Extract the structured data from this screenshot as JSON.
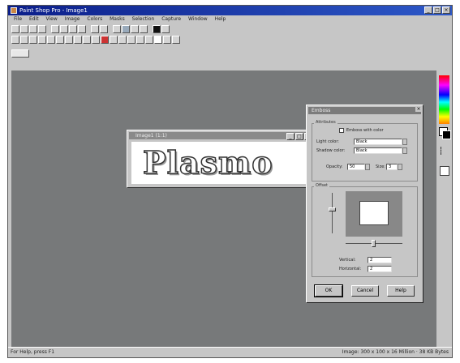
{
  "window": {
    "title": "Paint Shop Pro - Image1",
    "buttons": [
      "_",
      "□",
      "×"
    ]
  },
  "menu": [
    "File",
    "Edit",
    "View",
    "Image",
    "Colors",
    "Masks",
    "Selection",
    "Capture",
    "Window",
    "Help"
  ],
  "document": {
    "title": "Image1 (1:1)",
    "buttons": [
      "_",
      "□",
      "×"
    ],
    "text": "Plasmo"
  },
  "dialog": {
    "title": "Emboss",
    "close": "×",
    "attributes_label": "Attributes",
    "checkbox_label": "Emboss with color",
    "color_label": "Light color:",
    "color_value": "Black",
    "shadow_label": "Shadow color:",
    "shadow_value": "Black",
    "opacity_label": "Opacity:",
    "opacity_value": "50",
    "size_label": "Size:",
    "size_value": "3",
    "offset_label": "Offset",
    "vertical_label": "Vertical:",
    "vertical_value": "2",
    "horizontal_label": "Horizontal:",
    "horizontal_value": "2",
    "ok": "OK",
    "cancel": "Cancel",
    "help": "Help"
  },
  "status": {
    "left": "For Help, press F1",
    "right": "Image: 300 x 100 x 16 Million · 38 KB Bytes"
  },
  "colors": {
    "titlebar": "#0c1f8a",
    "workspace": "#77797a",
    "panel": "#c6c6c6"
  }
}
